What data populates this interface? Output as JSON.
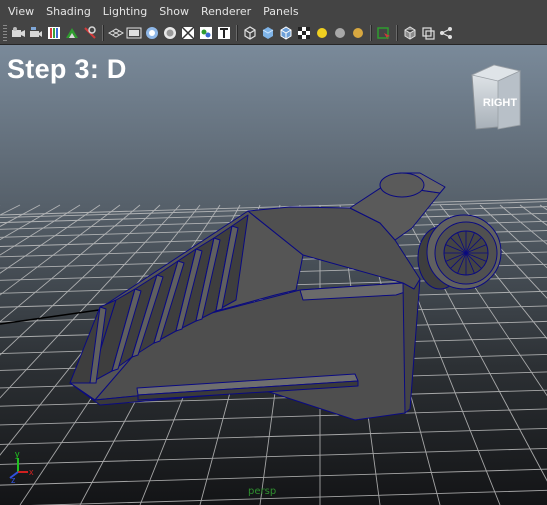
{
  "menubar": {
    "items": [
      "View",
      "Shading",
      "Lighting",
      "Show",
      "Renderer",
      "Panels"
    ]
  },
  "toolbar": {
    "icons": [
      "camera-select-icon",
      "camera-attributes-icon",
      "bookmarks-icon",
      "image-plane-icon",
      "two-d-pan-zoom-icon",
      "grid-icon",
      "film-gate-icon",
      "resolution-gate-icon",
      "gate-mask-icon",
      "field-chart-icon",
      "safe-action-icon",
      "safe-title-icon",
      "wireframe-icon",
      "smooth-shade-icon",
      "smooth-shade-wire-icon",
      "textured-icon",
      "use-lights-icon",
      "shadows-icon",
      "ambient-occlusion-icon",
      "isolate-select-icon",
      "xray-icon",
      "xray-joints-icon",
      "xray-components-icon"
    ]
  },
  "viewport": {
    "step_label": "Step 3: D",
    "view_cube_label": "RIGHT",
    "camera_label": "persp",
    "axis_labels": {
      "x": "x",
      "y": "y",
      "z": "z"
    }
  },
  "colors": {
    "viewport_top": "#6f8090",
    "viewport_bottom": "#151618",
    "grid": "#c8c8c8",
    "mesh_wire": "#0a0a80",
    "mesh_face": "#555555",
    "ui_bg": "#444444"
  }
}
